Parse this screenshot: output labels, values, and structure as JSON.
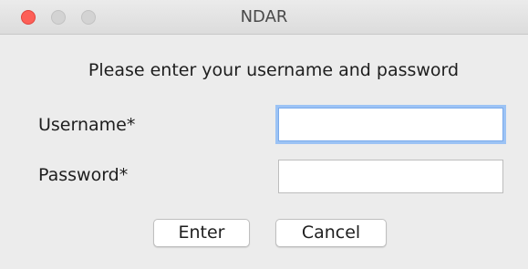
{
  "window": {
    "title": "NDAR"
  },
  "dialog": {
    "instruction": "Please enter your username and password",
    "username_label": "Username*",
    "username_value": "",
    "password_label": "Password*",
    "password_value": "",
    "enter_label": "Enter",
    "cancel_label": "Cancel"
  },
  "colors": {
    "close_button": "#fd5f57",
    "inactive_button": "#d3d3d3",
    "focus_ring": "#9cc3f5",
    "window_background": "#ececec"
  },
  "icons": [
    "close-icon",
    "minimize-icon",
    "zoom-icon"
  ]
}
